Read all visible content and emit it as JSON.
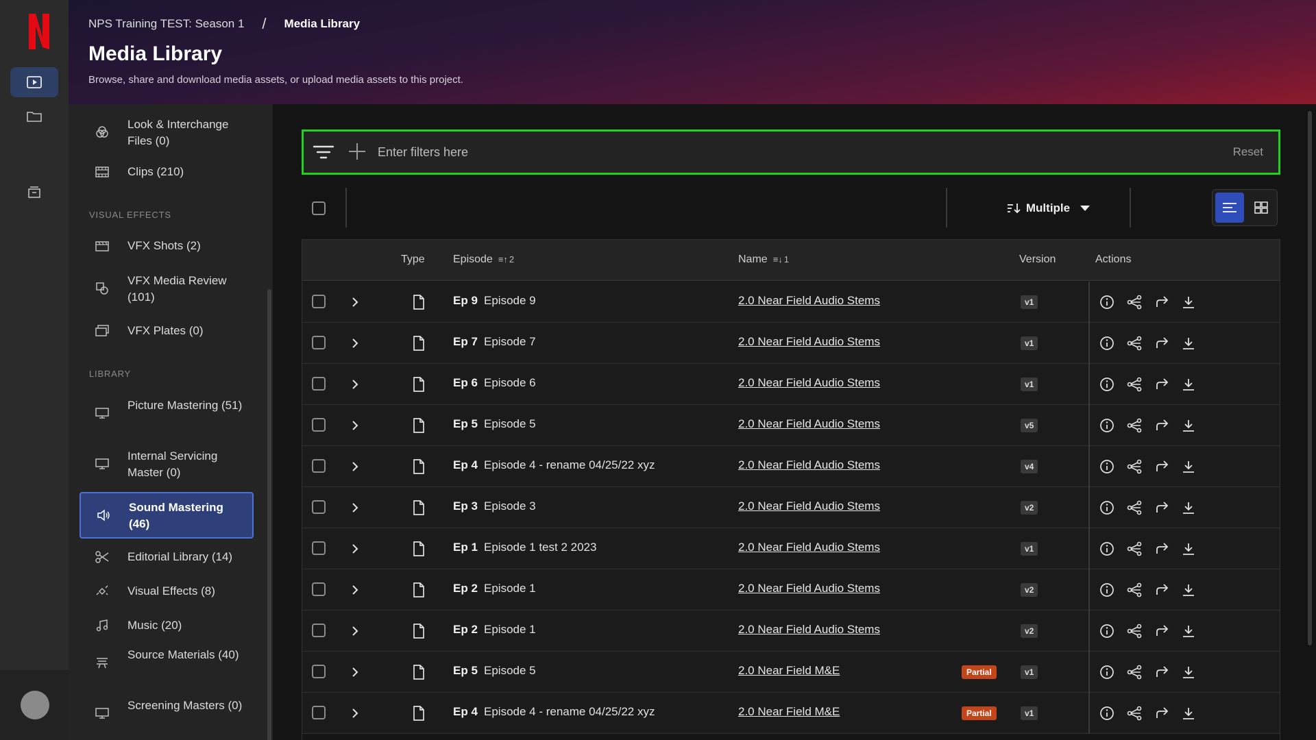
{
  "header": {
    "breadcrumb_project": "NPS Training TEST: Season 1",
    "breadcrumb_separator": "/",
    "breadcrumb_current": "Media Library",
    "title": "Media Library",
    "subtitle": "Browse, share and download media assets, or upload media assets to this project."
  },
  "sidebar": {
    "items_top": [
      {
        "label": "Look & Interchange Files (0)",
        "icon": "color-circles-icon"
      },
      {
        "label": "Clips (210)",
        "icon": "film-strip-icon"
      }
    ],
    "section_vfx": "VISUAL EFFECTS",
    "items_vfx": [
      {
        "label": "VFX Shots (2)",
        "icon": "clapper-icon"
      },
      {
        "label": "VFX Media Review (101)",
        "icon": "review-shapes-icon"
      },
      {
        "label": "VFX Plates (0)",
        "icon": "plates-icon"
      }
    ],
    "section_library": "LIBRARY",
    "items_library": [
      {
        "label": "Picture Mastering (51)",
        "icon": "monitor-icon"
      },
      {
        "label": "Internal Servicing Master (0)",
        "icon": "monitor-icon"
      },
      {
        "label": "Sound Mastering (46)",
        "icon": "speaker-icon",
        "active": true
      },
      {
        "label": "Editorial Library (14)",
        "icon": "scissors-icon"
      },
      {
        "label": "Visual Effects (8)",
        "icon": "sparkle-icon"
      },
      {
        "label": "Music (20)",
        "icon": "music-note-icon"
      },
      {
        "label": "Source Materials (40)",
        "icon": "source-stack-icon"
      },
      {
        "label": "Screening Masters (0)",
        "icon": "monitor-icon"
      }
    ]
  },
  "filter": {
    "placeholder": "Enter filters here",
    "reset_label": "Reset"
  },
  "toolbar": {
    "sort_label": "Multiple"
  },
  "table": {
    "columns": {
      "type": "Type",
      "episode": "Episode",
      "episode_sort_index": "2",
      "name": "Name",
      "name_sort_index": "1",
      "version": "Version",
      "actions": "Actions"
    },
    "rows": [
      {
        "ep": "Ep 9",
        "episode": "Episode 9",
        "name": "2.0 Near Field Audio Stems",
        "version": "v1",
        "badge": ""
      },
      {
        "ep": "Ep 7",
        "episode": "Episode 7",
        "name": "2.0 Near Field Audio Stems",
        "version": "v1",
        "badge": ""
      },
      {
        "ep": "Ep 6",
        "episode": "Episode 6",
        "name": "2.0 Near Field Audio Stems",
        "version": "v1",
        "badge": ""
      },
      {
        "ep": "Ep 5",
        "episode": "Episode 5",
        "name": "2.0 Near Field Audio Stems",
        "version": "v5",
        "badge": ""
      },
      {
        "ep": "Ep 4",
        "episode": "Episode 4 - rename 04/25/22 xyz",
        "name": "2.0 Near Field Audio Stems",
        "version": "v4",
        "badge": ""
      },
      {
        "ep": "Ep 3",
        "episode": "Episode 3",
        "name": "2.0 Near Field Audio Stems",
        "version": "v2",
        "badge": ""
      },
      {
        "ep": "Ep 1",
        "episode": "Episode 1 test 2 2023",
        "name": "2.0 Near Field Audio Stems",
        "version": "v1",
        "badge": ""
      },
      {
        "ep": "Ep 2",
        "episode": "Episode 1",
        "name": "2.0 Near Field Audio Stems",
        "version": "v2",
        "badge": ""
      },
      {
        "ep": "Ep 2",
        "episode": "Episode 1",
        "name": "2.0 Near Field Audio Stems",
        "version": "v2",
        "badge": ""
      },
      {
        "ep": "Ep 5",
        "episode": "Episode 5",
        "name": "2.0 Near Field M&E",
        "version": "v1",
        "badge": "Partial"
      },
      {
        "ep": "Ep 4",
        "episode": "Episode 4 - rename 04/25/22 xyz",
        "name": "2.0 Near Field M&E",
        "version": "v1",
        "badge": "Partial"
      }
    ]
  },
  "colors": {
    "accent": "#2e4dbb",
    "active_nav": "#2e3f7a",
    "filter_highlight": "#21d11f",
    "partial_badge": "#c2461a",
    "netflix_red": "#e50914"
  }
}
